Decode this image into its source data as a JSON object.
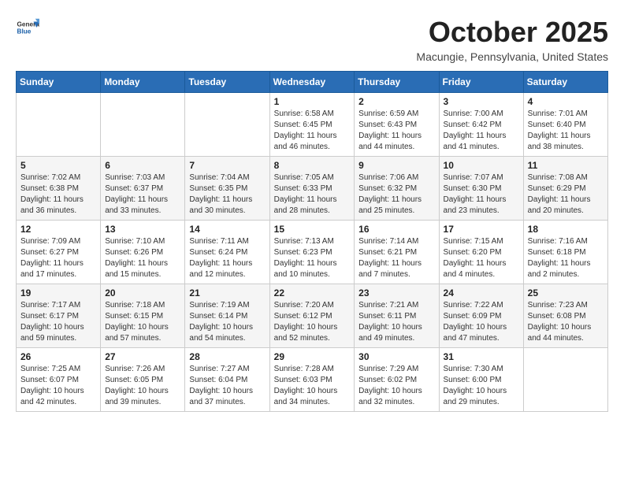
{
  "header": {
    "logo_line1": "General",
    "logo_line2": "Blue",
    "title": "October 2025",
    "location": "Macungie, Pennsylvania, United States"
  },
  "weekdays": [
    "Sunday",
    "Monday",
    "Tuesday",
    "Wednesday",
    "Thursday",
    "Friday",
    "Saturday"
  ],
  "weeks": [
    [
      {
        "day": "",
        "info": ""
      },
      {
        "day": "",
        "info": ""
      },
      {
        "day": "",
        "info": ""
      },
      {
        "day": "1",
        "info": "Sunrise: 6:58 AM\nSunset: 6:45 PM\nDaylight: 11 hours\nand 46 minutes."
      },
      {
        "day": "2",
        "info": "Sunrise: 6:59 AM\nSunset: 6:43 PM\nDaylight: 11 hours\nand 44 minutes."
      },
      {
        "day": "3",
        "info": "Sunrise: 7:00 AM\nSunset: 6:42 PM\nDaylight: 11 hours\nand 41 minutes."
      },
      {
        "day": "4",
        "info": "Sunrise: 7:01 AM\nSunset: 6:40 PM\nDaylight: 11 hours\nand 38 minutes."
      }
    ],
    [
      {
        "day": "5",
        "info": "Sunrise: 7:02 AM\nSunset: 6:38 PM\nDaylight: 11 hours\nand 36 minutes."
      },
      {
        "day": "6",
        "info": "Sunrise: 7:03 AM\nSunset: 6:37 PM\nDaylight: 11 hours\nand 33 minutes."
      },
      {
        "day": "7",
        "info": "Sunrise: 7:04 AM\nSunset: 6:35 PM\nDaylight: 11 hours\nand 30 minutes."
      },
      {
        "day": "8",
        "info": "Sunrise: 7:05 AM\nSunset: 6:33 PM\nDaylight: 11 hours\nand 28 minutes."
      },
      {
        "day": "9",
        "info": "Sunrise: 7:06 AM\nSunset: 6:32 PM\nDaylight: 11 hours\nand 25 minutes."
      },
      {
        "day": "10",
        "info": "Sunrise: 7:07 AM\nSunset: 6:30 PM\nDaylight: 11 hours\nand 23 minutes."
      },
      {
        "day": "11",
        "info": "Sunrise: 7:08 AM\nSunset: 6:29 PM\nDaylight: 11 hours\nand 20 minutes."
      }
    ],
    [
      {
        "day": "12",
        "info": "Sunrise: 7:09 AM\nSunset: 6:27 PM\nDaylight: 11 hours\nand 17 minutes."
      },
      {
        "day": "13",
        "info": "Sunrise: 7:10 AM\nSunset: 6:26 PM\nDaylight: 11 hours\nand 15 minutes."
      },
      {
        "day": "14",
        "info": "Sunrise: 7:11 AM\nSunset: 6:24 PM\nDaylight: 11 hours\nand 12 minutes."
      },
      {
        "day": "15",
        "info": "Sunrise: 7:13 AM\nSunset: 6:23 PM\nDaylight: 11 hours\nand 10 minutes."
      },
      {
        "day": "16",
        "info": "Sunrise: 7:14 AM\nSunset: 6:21 PM\nDaylight: 11 hours\nand 7 minutes."
      },
      {
        "day": "17",
        "info": "Sunrise: 7:15 AM\nSunset: 6:20 PM\nDaylight: 11 hours\nand 4 minutes."
      },
      {
        "day": "18",
        "info": "Sunrise: 7:16 AM\nSunset: 6:18 PM\nDaylight: 11 hours\nand 2 minutes."
      }
    ],
    [
      {
        "day": "19",
        "info": "Sunrise: 7:17 AM\nSunset: 6:17 PM\nDaylight: 10 hours\nand 59 minutes."
      },
      {
        "day": "20",
        "info": "Sunrise: 7:18 AM\nSunset: 6:15 PM\nDaylight: 10 hours\nand 57 minutes."
      },
      {
        "day": "21",
        "info": "Sunrise: 7:19 AM\nSunset: 6:14 PM\nDaylight: 10 hours\nand 54 minutes."
      },
      {
        "day": "22",
        "info": "Sunrise: 7:20 AM\nSunset: 6:12 PM\nDaylight: 10 hours\nand 52 minutes."
      },
      {
        "day": "23",
        "info": "Sunrise: 7:21 AM\nSunset: 6:11 PM\nDaylight: 10 hours\nand 49 minutes."
      },
      {
        "day": "24",
        "info": "Sunrise: 7:22 AM\nSunset: 6:09 PM\nDaylight: 10 hours\nand 47 minutes."
      },
      {
        "day": "25",
        "info": "Sunrise: 7:23 AM\nSunset: 6:08 PM\nDaylight: 10 hours\nand 44 minutes."
      }
    ],
    [
      {
        "day": "26",
        "info": "Sunrise: 7:25 AM\nSunset: 6:07 PM\nDaylight: 10 hours\nand 42 minutes."
      },
      {
        "day": "27",
        "info": "Sunrise: 7:26 AM\nSunset: 6:05 PM\nDaylight: 10 hours\nand 39 minutes."
      },
      {
        "day": "28",
        "info": "Sunrise: 7:27 AM\nSunset: 6:04 PM\nDaylight: 10 hours\nand 37 minutes."
      },
      {
        "day": "29",
        "info": "Sunrise: 7:28 AM\nSunset: 6:03 PM\nDaylight: 10 hours\nand 34 minutes."
      },
      {
        "day": "30",
        "info": "Sunrise: 7:29 AM\nSunset: 6:02 PM\nDaylight: 10 hours\nand 32 minutes."
      },
      {
        "day": "31",
        "info": "Sunrise: 7:30 AM\nSunset: 6:00 PM\nDaylight: 10 hours\nand 29 minutes."
      },
      {
        "day": "",
        "info": ""
      }
    ]
  ]
}
